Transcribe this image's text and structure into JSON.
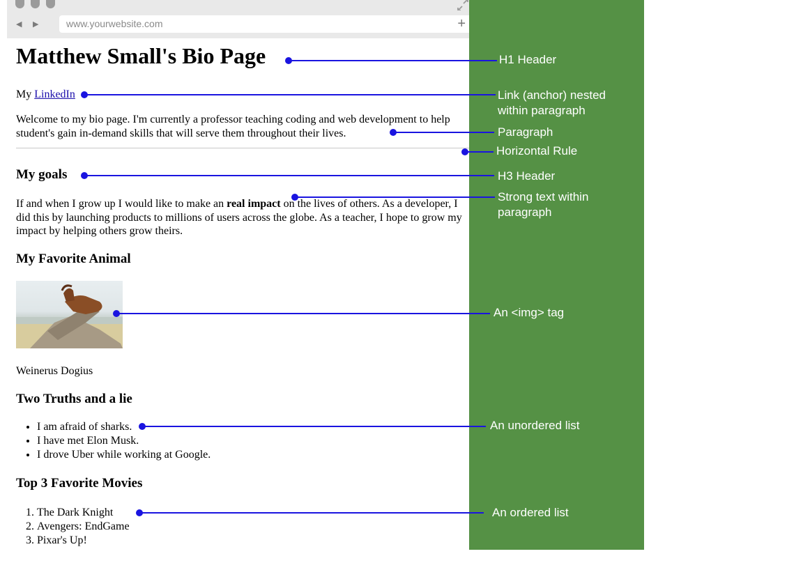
{
  "browser": {
    "url": "www.yourwebsite.com",
    "back_icon": "back-arrow-icon",
    "forward_icon": "forward-arrow-icon",
    "new_tab_icon": "plus-icon",
    "expand_icon": "expand-icon"
  },
  "page": {
    "h1": "Matthew Small's Bio Page",
    "link_prefix": "My ",
    "link_text": "LinkedIn",
    "intro": "Welcome to my bio page. I'm currently a professor teaching coding and web development to help student's gain in-demand skills that will serve them throughout their lives.",
    "goals_heading": "My goals",
    "goals_text_before": "If and when I grow up I would like to make an ",
    "goals_strong": "real impact",
    "goals_text_after": " on the lives of others. As a developer, I did this by launching products to millions of users across the globe. As a teacher, I hope to grow my impact by helping others grow theirs.",
    "animal_heading": "My Favorite Animal",
    "animal_caption": "Weinerus Dogius",
    "truths_heading": "Two Truths and a lie",
    "truths": [
      "I am afraid of sharks.",
      "I have met Elon Musk.",
      "I drove Uber while working at Google."
    ],
    "movies_heading": "Top 3 Favorite Movies",
    "movies": [
      "The Dark Knight",
      "Avengers: EndGame",
      "Pixar's Up!"
    ]
  },
  "annotations": {
    "h1": "H1 Header",
    "link": "Link (anchor) nested within paragraph",
    "paragraph": "Paragraph",
    "hr": "Horizontal Rule",
    "h3": "H3 Header",
    "strong": "Strong text within paragraph",
    "img": "An <img> tag",
    "ul": "An unordered list",
    "ol": "An ordered list"
  },
  "colors": {
    "sidebar": "#559145",
    "connector": "#1a14e0",
    "link": "#1a0dab"
  }
}
